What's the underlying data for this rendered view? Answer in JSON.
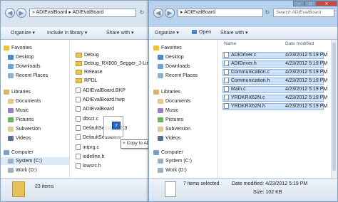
{
  "left": {
    "breadcrumb": [
      "ADIEvalBoard",
      "ADIEvalBoard"
    ],
    "toolbar": {
      "organize": "Organize ▾",
      "include": "Include in library ▾",
      "share": "Share with ▾"
    },
    "files": [
      "Debug",
      "Debug_RX600_Segger_J-Link",
      "Release",
      "RPDL",
      "ADIEvalBoard.BKP",
      "ADIEvalBoard.hwp",
      "ADIEvalBoard",
      "dbsct.c",
      "DefaultSession.BK3",
      "DefaultSession.h",
      "intprg.c",
      "iodefine.h",
      "lowsrc.h"
    ],
    "status": {
      "count": "23 items"
    }
  },
  "right": {
    "breadcrumb": "ADIEvalBoard",
    "search_placeholder": "Search ADIEvalBoard",
    "toolbar": {
      "organize": "Organize ▾",
      "open": "Open",
      "share": "Share with ▾"
    },
    "columns": {
      "name": "Name",
      "date": "Date modified"
    },
    "files": [
      {
        "name": "ADIDriver.c",
        "date": "4/23/2012 5:19 PM"
      },
      {
        "name": "ADIDriver.h",
        "date": "4/23/2012 5:19 PM"
      },
      {
        "name": "Communication.c",
        "date": "4/23/2012 5:19 PM"
      },
      {
        "name": "Communication.h",
        "date": "4/23/2012 5:19 PM"
      },
      {
        "name": "Main.c",
        "date": "4/23/2012 5:19 PM"
      },
      {
        "name": "YRDKRX62N.c",
        "date": "4/23/2012 5:19 PM"
      },
      {
        "name": "YRDKRX62N.h",
        "date": "4/23/2012 5:19 PM"
      }
    ],
    "status": {
      "selected": "7 items selected",
      "date_label": "Date modified: 4/23/2012 5:19 PM",
      "size_label": "Size: 102 KB"
    }
  },
  "nav": {
    "favorites": "Favorites",
    "desktop": "Desktop",
    "downloads": "Downloads",
    "recent": "Recent Places",
    "libraries": "Libraries",
    "documents": "Documents",
    "music": "Music",
    "pictures": "Pictures",
    "subversion": "Subversion",
    "videos": "Videos",
    "computer": "Computer",
    "system": "System (C:)",
    "work": "Work (D:)"
  },
  "drag": {
    "tooltip": "Copy to ADIEvalBoard",
    "count": "7"
  },
  "colors": {
    "selection": "#cce1f8",
    "accent": "#2a64c2"
  }
}
